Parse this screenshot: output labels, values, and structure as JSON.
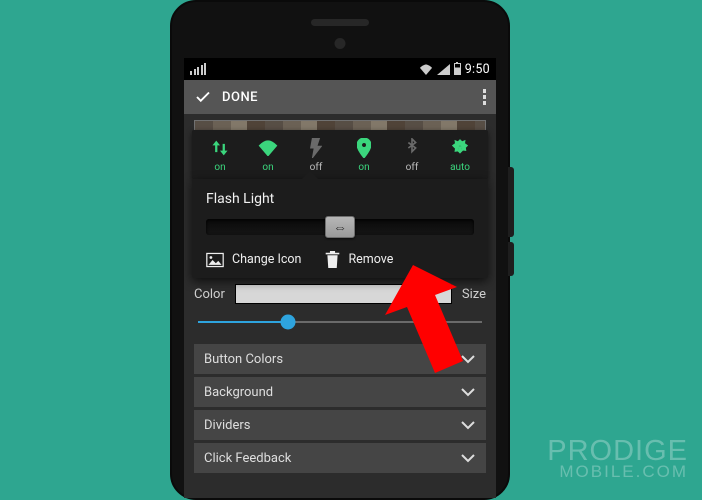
{
  "statusbar": {
    "time": "9:50"
  },
  "donebar": {
    "label": "DONE"
  },
  "toggles": [
    {
      "name": "data-toggle",
      "icon": "data-arrows",
      "state": "on",
      "label": "on"
    },
    {
      "name": "wifi-toggle",
      "icon": "wifi",
      "state": "on",
      "label": "on"
    },
    {
      "name": "flash-toggle",
      "icon": "flash",
      "state": "dim",
      "label": "off"
    },
    {
      "name": "location-toggle",
      "icon": "location",
      "state": "on",
      "label": "on"
    },
    {
      "name": "bluetooth-toggle",
      "icon": "bluetooth",
      "state": "dim",
      "label": "off"
    },
    {
      "name": "brightness-toggle",
      "icon": "brightness-a",
      "state": "on",
      "label": "auto"
    }
  ],
  "popup": {
    "title": "Flash Light",
    "change_icon_label": "Change Icon",
    "remove_label": "Remove"
  },
  "color_row": {
    "left_label": "Color",
    "right_label": "Size"
  },
  "rows": [
    {
      "label": "Button Colors"
    },
    {
      "label": "Background"
    },
    {
      "label": "Dividers"
    },
    {
      "label": "Click Feedback"
    }
  ],
  "watermark": {
    "line1": "PRODIGE",
    "line2": "MOBILE.COM"
  }
}
